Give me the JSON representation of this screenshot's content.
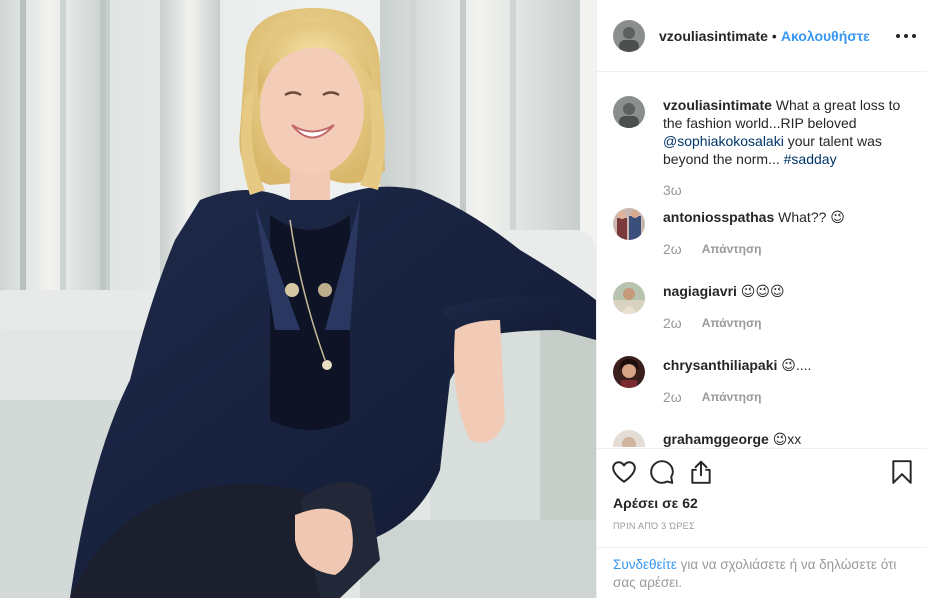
{
  "post": {
    "author": "vzouliasintimate",
    "separator": "•",
    "follow_label": "Ακολουθήστε",
    "caption": {
      "user": "vzouliasintimate",
      "text_before": " What a great loss to the fashion world...RIP beloved ",
      "mention": "@sophiakokosalaki",
      "text_after": " your talent was beyond the norm... ",
      "hashtag": "#sadday",
      "time": "3ω"
    }
  },
  "comments": [
    {
      "user": "antoniosspathas",
      "text": " What?? 😉",
      "time": "2ω",
      "reply": "Απάντηση"
    },
    {
      "user": "nagiagiavri",
      "text": " 😉😉😉",
      "time": "2ω",
      "reply": "Απάντηση"
    },
    {
      "user": "chrysanthiliapaki",
      "text": " 😉....",
      "time": "2ω",
      "reply": "Απάντηση"
    },
    {
      "user": "grahamggeorge",
      "text": " 😉xx"
    }
  ],
  "stats": {
    "likes": "Αρέσει σε 62",
    "posted": "ΠΡΙΝ ΑΠΌ 3 ΏΡΕΣ"
  },
  "login_prompt": {
    "link": "Συνδεθείτε",
    "text": " για να σχολιάσετε ή να δηλώσετε ότι σας αρέσει."
  },
  "icons": [
    "heart-icon",
    "comment-icon",
    "share-icon",
    "bookmark-icon",
    "more-icon"
  ],
  "colors": {
    "link": "#3897f0",
    "mention": "#003569",
    "muted": "#999999",
    "text": "#262626",
    "border": "#efefef"
  }
}
